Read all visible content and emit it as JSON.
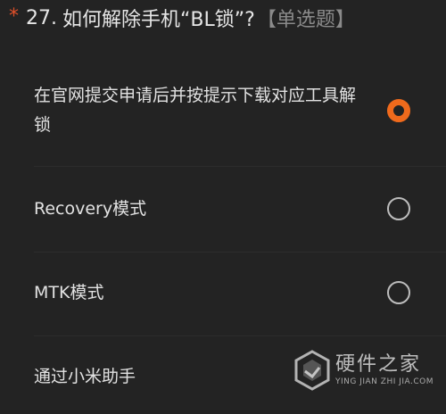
{
  "question": {
    "required_mark": "*",
    "number": "27.",
    "text": "如何解除手机“BL锁”?",
    "type_label": "【单选题】"
  },
  "options": [
    {
      "label": "在官网提交申请后并按提示下载对应工具解锁",
      "selected": true
    },
    {
      "label": "Recovery模式",
      "selected": false
    },
    {
      "label": "MTK模式",
      "selected": false
    },
    {
      "label": "通过小米助手",
      "selected": false
    }
  ],
  "watermark": {
    "brand": "硬件之家",
    "url": "YING JIAN ZHI JIA.COM"
  },
  "colors": {
    "background": "#232323",
    "accent": "#f06a1c",
    "required": "#e0502a",
    "text": "#e2e2e2",
    "muted": "#8a8a8a"
  }
}
